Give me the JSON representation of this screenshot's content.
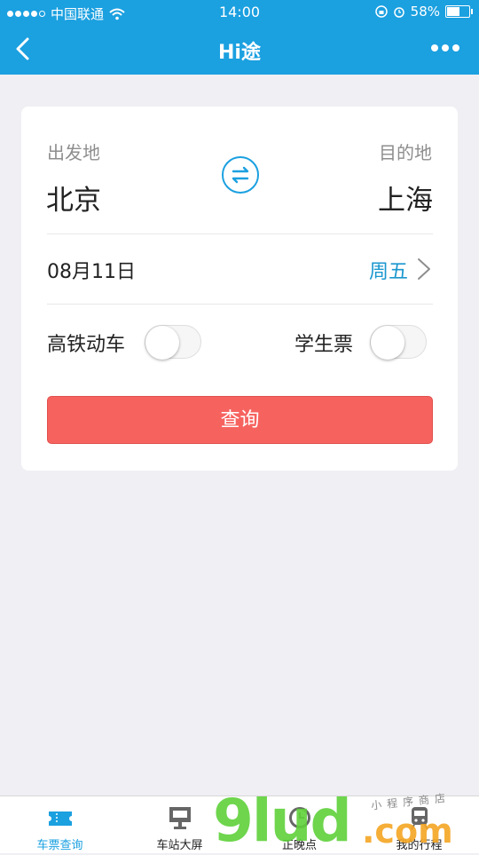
{
  "status_bar": {
    "carrier": "中国联通",
    "time": "14:00",
    "battery": "58%",
    "battery_level": 0.58
  },
  "nav": {
    "title": "Hi途",
    "back_icon": "chevron-left-icon",
    "more_icon": "more-dots-icon"
  },
  "search": {
    "from_label": "出发地",
    "from_city": "北京",
    "to_label": "目的地",
    "to_city": "上海",
    "date": "08月11日",
    "weekday": "周五",
    "toggle_highspeed_label": "高铁动车",
    "toggle_highspeed_on": false,
    "toggle_student_label": "学生票",
    "toggle_student_on": false,
    "query_button": "查询"
  },
  "tabs": [
    {
      "label": "车票查询",
      "icon": "ticket-icon",
      "active": true
    },
    {
      "label": "车站大屏",
      "icon": "monitor-icon",
      "active": false
    },
    {
      "label": "正晚点",
      "icon": "clock-icon",
      "active": false
    },
    {
      "label": "我的行程",
      "icon": "train-icon",
      "active": false
    }
  ],
  "watermark": {
    "main": "9lud",
    "domain": ".com",
    "tagline": "小程序商店"
  },
  "colors": {
    "primary": "#1ba0e0",
    "query_button": "#f6635f",
    "background": "#efeff4"
  }
}
